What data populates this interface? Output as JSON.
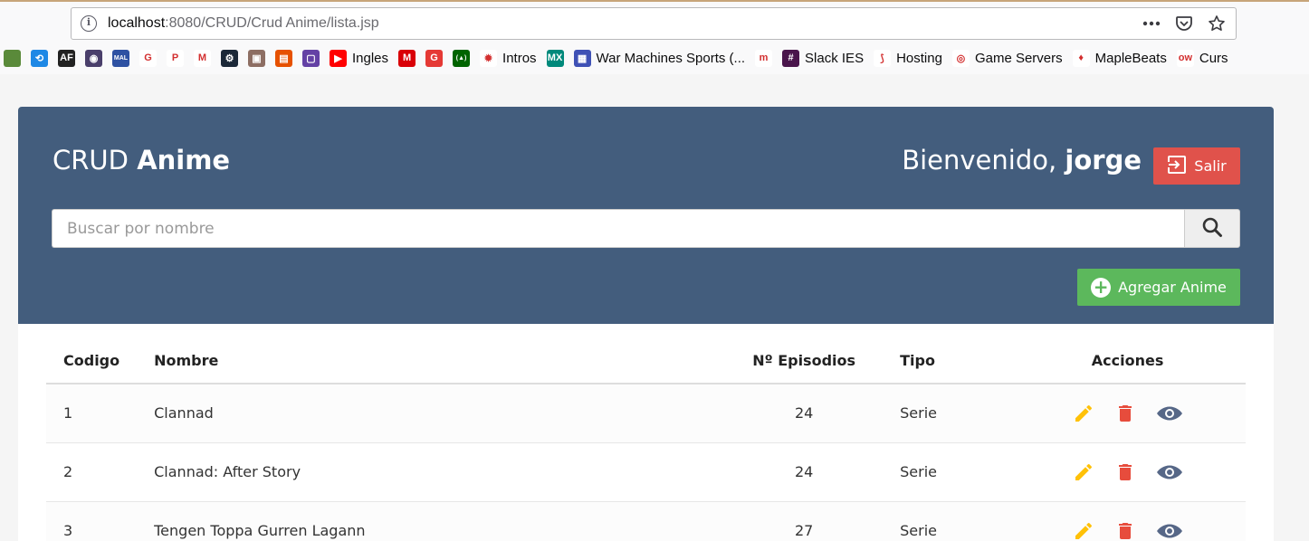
{
  "browser": {
    "url_host": "localhost",
    "url_rest": ":8080/CRUD/Crud Anime/lista.jsp",
    "bookmarks": [
      {
        "label": "",
        "icon": "minecraft-icon",
        "color": "#5a8a3a",
        "glyph": ""
      },
      {
        "label": "",
        "icon": "bookmark-circle-icon",
        "color": "#1e88e5",
        "glyph": "⟲"
      },
      {
        "label": "",
        "icon": "af-icon",
        "color": "#222222",
        "glyph": "AF"
      },
      {
        "label": "",
        "icon": "anime-planet-icon",
        "color": "#4a3f6b",
        "glyph": "◉"
      },
      {
        "label": "",
        "icon": "mal-icon",
        "color": "#2e51a2",
        "glyph": "MAL"
      },
      {
        "label": "",
        "icon": "google-icon",
        "color": "#ffffff",
        "glyph": "G"
      },
      {
        "label": "",
        "icon": "paypal-icon",
        "color": "#ffffff",
        "glyph": "P"
      },
      {
        "label": "",
        "icon": "gmail-icon",
        "color": "#ffffff",
        "glyph": "M"
      },
      {
        "label": "",
        "icon": "steam-icon",
        "color": "#1b2838",
        "glyph": "⚙"
      },
      {
        "label": "",
        "icon": "box-icon",
        "color": "#8d6e63",
        "glyph": "▣"
      },
      {
        "label": "",
        "icon": "tv-icon",
        "color": "#e65100",
        "glyph": "▤"
      },
      {
        "label": "",
        "icon": "twitch-icon",
        "color": "#6441a5",
        "glyph": "▢"
      },
      {
        "label": "Ingles",
        "icon": "youtube-icon",
        "color": "#ff0000",
        "glyph": "▶"
      },
      {
        "label": "",
        "icon": "mega-icon",
        "color": "#d90007",
        "glyph": "M"
      },
      {
        "label": "",
        "icon": "grammarly-icon",
        "color": "#e53935",
        "glyph": "G"
      },
      {
        "label": "",
        "icon": "freecodecamp-icon",
        "color": "#006400",
        "glyph": "(▲)"
      },
      {
        "label": "Intros",
        "icon": "gear-red-icon",
        "color": "#ffffff",
        "glyph": "✹"
      },
      {
        "label": "",
        "icon": "mx-icon",
        "color": "#00897b",
        "glyph": "MX"
      },
      {
        "label": "War Machines Sports (...",
        "icon": "window-icon",
        "color": "#3f51b5",
        "glyph": "▦"
      },
      {
        "label": "",
        "icon": "moodle-icon",
        "color": "#ffffff",
        "glyph": "m"
      },
      {
        "label": "Slack IES",
        "icon": "slack-icon",
        "color": "#4a154b",
        "glyph": "#"
      },
      {
        "label": "Hosting",
        "icon": "hosting-icon",
        "color": "#ffffff",
        "glyph": "⟆"
      },
      {
        "label": "Game Servers",
        "icon": "game-servers-icon",
        "color": "#ffffff",
        "glyph": "◎"
      },
      {
        "label": "MapleBeats",
        "icon": "maplebeats-icon",
        "color": "#ffffff",
        "glyph": "♦"
      },
      {
        "label": "Curs",
        "icon": "ow-icon",
        "color": "#ffffff",
        "glyph": "ow"
      }
    ]
  },
  "header": {
    "brand_light": "CRUD ",
    "brand_bold": "Anime",
    "welcome_text": "Bienvenido, ",
    "username": "jorge",
    "logout_label": "Salir",
    "add_label": "Agregar Anime"
  },
  "search": {
    "placeholder": "Buscar por nombre"
  },
  "table": {
    "headers": {
      "code": "Codigo",
      "name": "Nombre",
      "episodes": "Nº Episodios",
      "type": "Tipo",
      "actions": "Acciones"
    },
    "rows": [
      {
        "code": "1",
        "name": "Clannad",
        "episodes": "24",
        "type": "Serie"
      },
      {
        "code": "2",
        "name": "Clannad: After Story",
        "episodes": "24",
        "type": "Serie"
      },
      {
        "code": "3",
        "name": "Tengen Toppa Gurren Lagann",
        "episodes": "27",
        "type": "Serie"
      }
    ]
  },
  "colors": {
    "header_bg": "#435d7d",
    "logout_btn": "#e0524b",
    "add_btn": "#5cb85c",
    "edit_icon": "#ffc107",
    "delete_icon": "#e74c3c",
    "view_icon": "#566787"
  }
}
